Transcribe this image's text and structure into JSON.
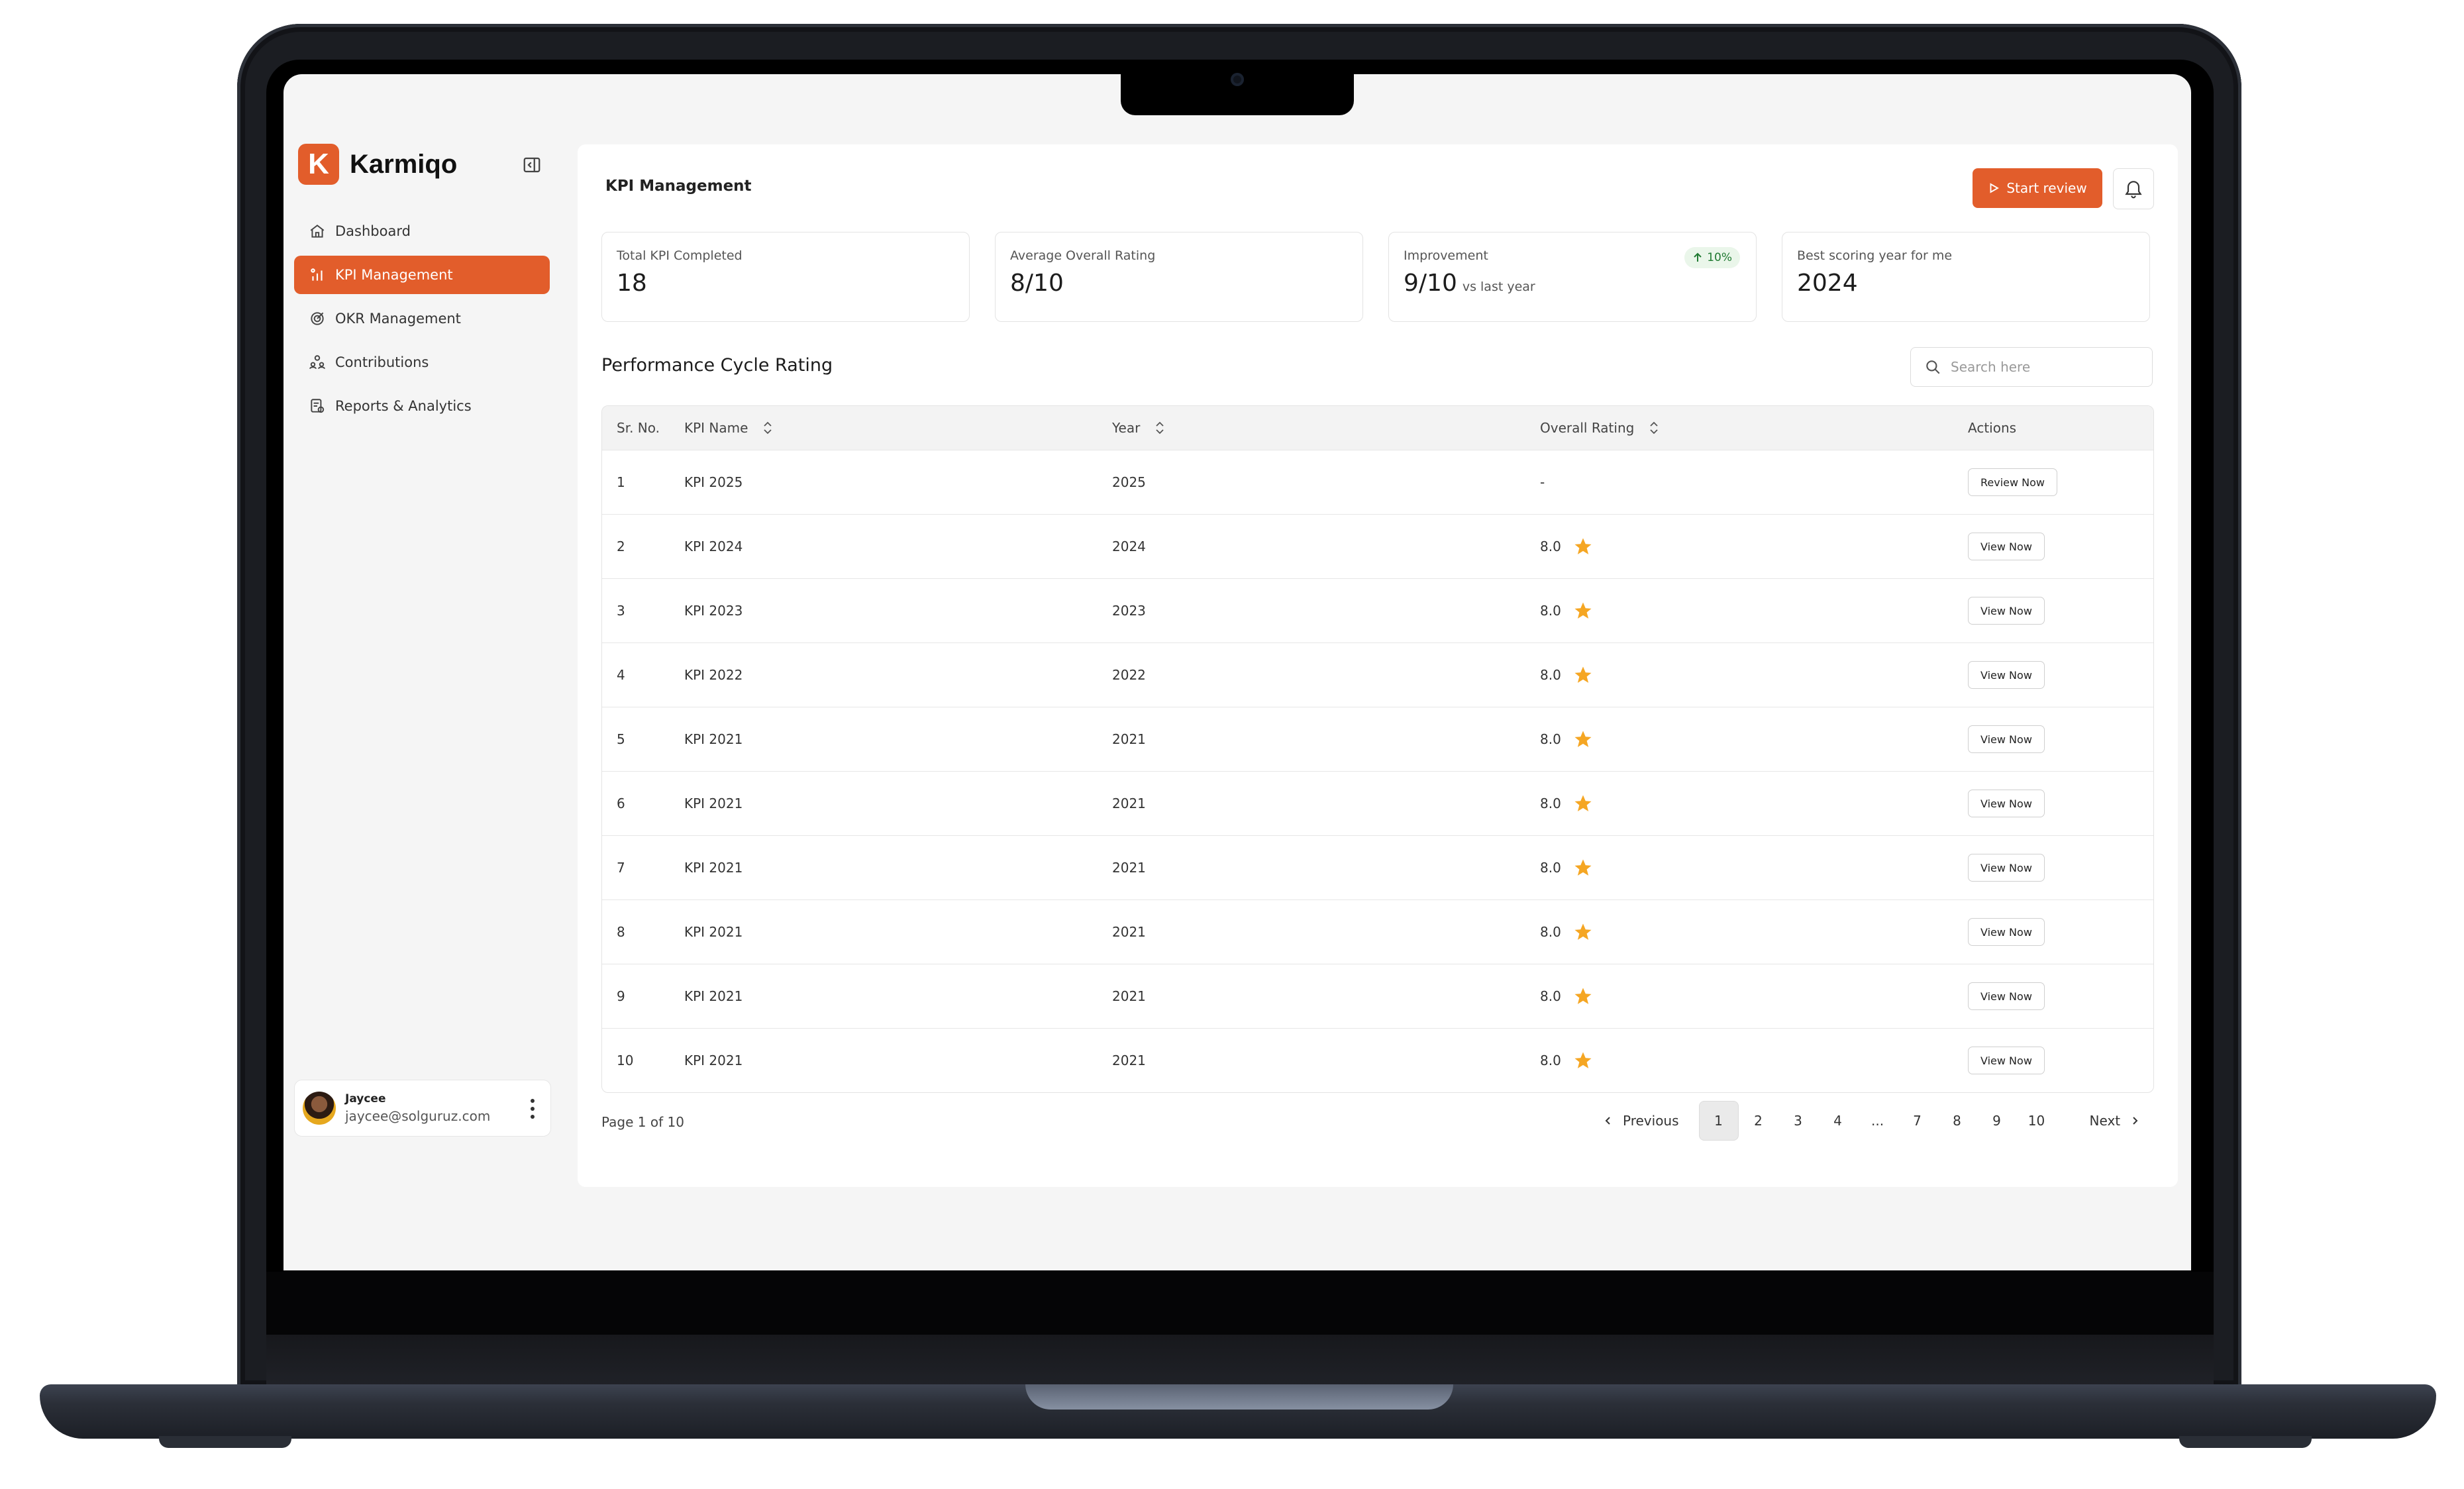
{
  "app": {
    "name": "Karmiqo",
    "logo_letter": "K",
    "accent": "#e25d2b"
  },
  "sidebar": {
    "items": [
      {
        "label": "Dashboard",
        "icon": "home-icon",
        "active": false
      },
      {
        "label": "KPI Management",
        "icon": "bar-chart-icon",
        "active": true
      },
      {
        "label": "OKR Management",
        "icon": "target-icon",
        "active": false
      },
      {
        "label": "Contributions",
        "icon": "people-icon",
        "active": false
      },
      {
        "label": "Reports & Analytics",
        "icon": "report-icon",
        "active": false
      }
    ],
    "user": {
      "name": "Jaycee",
      "email": "jaycee@solguruz.com"
    }
  },
  "header": {
    "title": "KPI Management",
    "start_label": "Start review"
  },
  "stats": [
    {
      "label": "Total KPI Completed",
      "value": "18"
    },
    {
      "label": "Average Overall Rating",
      "value": "8/10"
    },
    {
      "label": "Improvement",
      "value": "9/10",
      "suffix": "vs last year",
      "badge": "10%"
    },
    {
      "label": "Best scoring year for me",
      "value": "2024"
    }
  ],
  "section": {
    "title": "Performance Cycle Rating",
    "search_placeholder": "Search here"
  },
  "table": {
    "headers": [
      "Sr. No.",
      "KPI Name",
      "Year",
      "Overall Rating",
      "Actions"
    ],
    "rows": [
      {
        "sr": "1",
        "name": "KPI 2025",
        "year": "2025",
        "rating": "-",
        "star": false,
        "action": "Review Now"
      },
      {
        "sr": "2",
        "name": "KPI 2024",
        "year": "2024",
        "rating": "8.0",
        "star": true,
        "action": "View Now"
      },
      {
        "sr": "3",
        "name": "KPI 2023",
        "year": "2023",
        "rating": "8.0",
        "star": true,
        "action": "View Now"
      },
      {
        "sr": "4",
        "name": "KPI 2022",
        "year": "2022",
        "rating": "8.0",
        "star": true,
        "action": "View Now"
      },
      {
        "sr": "5",
        "name": "KPI 2021",
        "year": "2021",
        "rating": "8.0",
        "star": true,
        "action": "View Now"
      },
      {
        "sr": "6",
        "name": "KPI 2021",
        "year": "2021",
        "rating": "8.0",
        "star": true,
        "action": "View Now"
      },
      {
        "sr": "7",
        "name": "KPI 2021",
        "year": "2021",
        "rating": "8.0",
        "star": true,
        "action": "View Now"
      },
      {
        "sr": "8",
        "name": "KPI 2021",
        "year": "2021",
        "rating": "8.0",
        "star": true,
        "action": "View Now"
      },
      {
        "sr": "9",
        "name": "KPI 2021",
        "year": "2021",
        "rating": "8.0",
        "star": true,
        "action": "View Now"
      },
      {
        "sr": "10",
        "name": "KPI 2021",
        "year": "2021",
        "rating": "8.0",
        "star": true,
        "action": "View Now"
      }
    ]
  },
  "pagination": {
    "info": "Page 1 of 10",
    "previous": "Previous",
    "next": "Next",
    "pages": [
      "1",
      "2",
      "3",
      "4",
      "...",
      "7",
      "8",
      "9",
      "10"
    ],
    "current": "1"
  },
  "colors": {
    "star": "#f5a623",
    "badge_text": "#1f7a31",
    "badge_bg": "#eaf6ea"
  }
}
